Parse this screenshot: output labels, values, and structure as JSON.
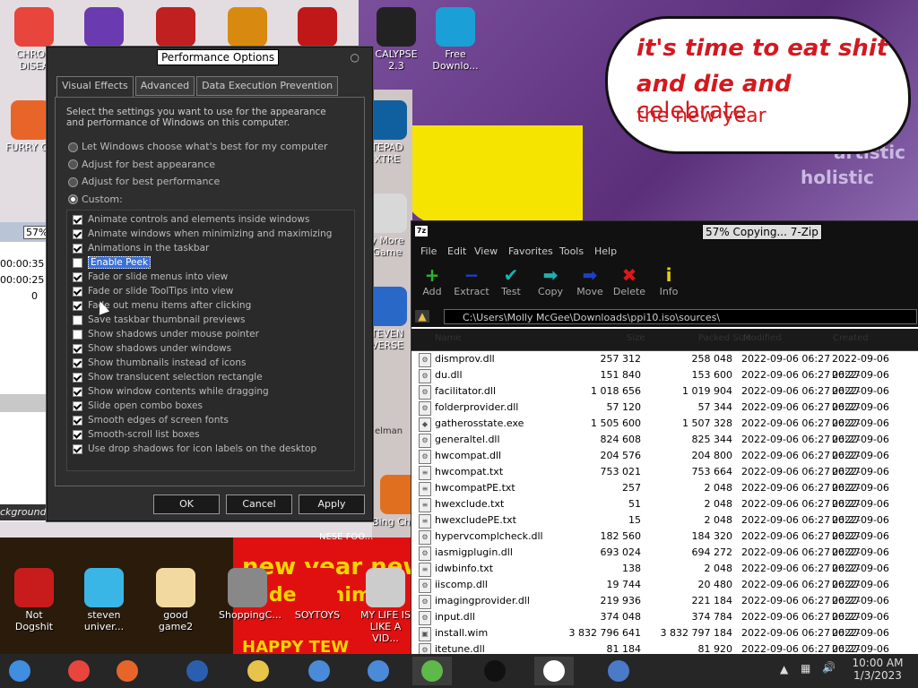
{
  "desktop": {
    "speech_bubble": {
      "line1": "it's time to eat shit",
      "line2_bold": "and die and",
      "line2_normal": "celebrate",
      "line3": "the new year"
    },
    "art_text_1": "artistic",
    "art_text_2": "holistic",
    "icons": [
      {
        "label": "CHRON DISEA",
        "icon": "chrome-icon",
        "color": "#e8453c"
      },
      {
        "label": "",
        "icon": "visual-studio-icon",
        "color": "#6a3bb0"
      },
      {
        "label": "",
        "icon": "bubble-2-icon",
        "color": "#c02020"
      },
      {
        "label": "",
        "icon": "p-logo-icon",
        "color": "#d88a10"
      },
      {
        "label": "",
        "icon": "devil-icon",
        "color": "#c01818"
      },
      {
        "label": "CALYPSE 2.3",
        "icon": "terminal-icon",
        "color": "#222222"
      },
      {
        "label": "Free Downlo...",
        "icon": "download-icon",
        "color": "#1a9fd6"
      },
      {
        "label": "FURRY CO",
        "icon": "firefox-icon",
        "color": "#e8652a"
      },
      {
        "label": "TEPAD XTRE",
        "icon": "notepad-icon",
        "color": "#1060a0"
      },
      {
        "label": "y More Game",
        "icon": "popcap-icon",
        "color": "#d8d8d8"
      },
      {
        "label": "TEVEN VERSE",
        "icon": "steven-icon",
        "color": "#2a68c8"
      },
      {
        "label": "Bing Chillin",
        "icon": "bing-icon",
        "color": "#e07020"
      },
      {
        "label": "Not Dogshit",
        "icon": "dev-cpp-icon",
        "color": "#c81c1c"
      },
      {
        "label": "steven univer...",
        "icon": "diamond-icon",
        "color": "#3ab6e6"
      },
      {
        "label": "good game2",
        "icon": "torii-icon",
        "color": "#f2d9a0"
      },
      {
        "label": "ShoppingC...",
        "icon": "flash-icon",
        "color": "#888888"
      },
      {
        "label": "SOYTOYS",
        "icon": "s-logo-icon",
        "color": "#e01010"
      },
      {
        "label": "MY LIFE IS LIKE A VID...",
        "icon": "gamepad-icon",
        "color": "#cccccc"
      }
    ],
    "red_banner_text": "new year new",
    "red_banner_text2": "jaiden anime",
    "red_banner_text3": "HAPPY TEW",
    "dark_banner_text": "NESE FOO...",
    "elman_text": "elman"
  },
  "left_window": {
    "percent": "57%",
    "time1": "00:00:35",
    "time2": "00:00:25",
    "value": "0",
    "footer": "ckground"
  },
  "perf": {
    "title": "Performance Options",
    "tabs": [
      "Visual Effects",
      "Advanced",
      "Data Execution Prevention"
    ],
    "description": "Select the settings you want to use for the appearance and performance of Windows on this computer.",
    "radios": [
      {
        "label": "Let Windows choose what's best for my computer",
        "selected": false
      },
      {
        "label": "Adjust for best appearance",
        "selected": false
      },
      {
        "label": "Adjust for best performance",
        "selected": false
      },
      {
        "label": "Custom:",
        "selected": true
      }
    ],
    "options": [
      {
        "label": "Animate controls and elements inside windows",
        "checked": true
      },
      {
        "label": "Animate windows when minimizing and maximizing",
        "checked": true
      },
      {
        "label": "Animations in the taskbar",
        "checked": true
      },
      {
        "label": "Enable Peek",
        "checked": false,
        "focused": true
      },
      {
        "label": "Fade or slide menus into view",
        "checked": true
      },
      {
        "label": "Fade or slide ToolTips into view",
        "checked": true
      },
      {
        "label": "Fade out menu items after clicking",
        "checked": true
      },
      {
        "label": "Save taskbar thumbnail previews",
        "checked": false
      },
      {
        "label": "Show shadows under mouse pointer",
        "checked": false
      },
      {
        "label": "Show shadows under windows",
        "checked": true
      },
      {
        "label": "Show thumbnails instead of icons",
        "checked": true
      },
      {
        "label": "Show translucent selection rectangle",
        "checked": true
      },
      {
        "label": "Show window contents while dragging",
        "checked": true
      },
      {
        "label": "Slide open combo boxes",
        "checked": true
      },
      {
        "label": "Smooth edges of screen fonts",
        "checked": true
      },
      {
        "label": "Smooth-scroll list boxes",
        "checked": true
      },
      {
        "label": "Use drop shadows for icon labels on the desktop",
        "checked": true
      }
    ],
    "buttons": {
      "ok": "OK",
      "cancel": "Cancel",
      "apply": "Apply"
    }
  },
  "zip": {
    "title": "57% Copying... 7-Zip",
    "menu": [
      "File",
      "Edit",
      "View",
      "Favorites",
      "Tools",
      "Help"
    ],
    "tools": [
      {
        "label": "Add",
        "icon": "plus-icon",
        "glyph": "+",
        "color": "#2cb52c"
      },
      {
        "label": "Extract",
        "icon": "minus-icon",
        "glyph": "−",
        "color": "#1d3fd1"
      },
      {
        "label": "Test",
        "icon": "check-icon",
        "glyph": "✔",
        "color": "#19b3b3"
      },
      {
        "label": "Copy",
        "icon": "copy-arrow-icon",
        "glyph": "➡",
        "color": "#19b3b3"
      },
      {
        "label": "Move",
        "icon": "move-arrow-icon",
        "glyph": "➡",
        "color": "#1d3fd1"
      },
      {
        "label": "Delete",
        "icon": "delete-x-icon",
        "glyph": "✖",
        "color": "#e01515"
      },
      {
        "label": "Info",
        "icon": "info-icon",
        "glyph": "i",
        "color": "#e6d000"
      }
    ],
    "path": "C:\\Users\\Molly McGee\\Downloads\\ppi10.iso\\sources\\",
    "columns": [
      "Name",
      "Size",
      "Packed Size",
      "Modified",
      "Created"
    ],
    "files": [
      {
        "name": "dismprov.dll",
        "type": "dll",
        "size": "257 312",
        "packed": "258 048",
        "modified": "2022-09-06 06:27",
        "created": "2022-09-06 06:27"
      },
      {
        "name": "du.dll",
        "type": "dll",
        "size": "151 840",
        "packed": "153 600",
        "modified": "2022-09-06 06:27",
        "created": "2022-09-06 06:27"
      },
      {
        "name": "facilitator.dll",
        "type": "dll",
        "size": "1 018 656",
        "packed": "1 019 904",
        "modified": "2022-09-06 06:27",
        "created": "2022-09-06 06:27"
      },
      {
        "name": "folderprovider.dll",
        "type": "dll",
        "size": "57 120",
        "packed": "57 344",
        "modified": "2022-09-06 06:27",
        "created": "2022-09-06 06:27"
      },
      {
        "name": "gatherosstate.exe",
        "type": "exe",
        "size": "1 505 600",
        "packed": "1 507 328",
        "modified": "2022-09-06 06:27",
        "created": "2022-09-06 06:27"
      },
      {
        "name": "generaltel.dll",
        "type": "dll",
        "size": "824 608",
        "packed": "825 344",
        "modified": "2022-09-06 06:27",
        "created": "2022-09-06 06:27"
      },
      {
        "name": "hwcompat.dll",
        "type": "dll",
        "size": "204 576",
        "packed": "204 800",
        "modified": "2022-09-06 06:27",
        "created": "2022-09-06 06:27"
      },
      {
        "name": "hwcompat.txt",
        "type": "txt",
        "size": "753 021",
        "packed": "753 664",
        "modified": "2022-09-06 06:27",
        "created": "2022-09-06 06:27"
      },
      {
        "name": "hwcompatPE.txt",
        "type": "txt",
        "size": "257",
        "packed": "2 048",
        "modified": "2022-09-06 06:27",
        "created": "2022-09-06 06:27"
      },
      {
        "name": "hwexclude.txt",
        "type": "txt",
        "size": "51",
        "packed": "2 048",
        "modified": "2022-09-06 06:27",
        "created": "2022-09-06 06:27"
      },
      {
        "name": "hwexcludePE.txt",
        "type": "txt",
        "size": "15",
        "packed": "2 048",
        "modified": "2022-09-06 06:27",
        "created": "2022-09-06 06:27"
      },
      {
        "name": "hypervcomplcheck.dll",
        "type": "dll",
        "size": "182 560",
        "packed": "184 320",
        "modified": "2022-09-06 06:27",
        "created": "2022-09-06 06:27"
      },
      {
        "name": "iasmigplugin.dll",
        "type": "dll",
        "size": "693 024",
        "packed": "694 272",
        "modified": "2022-09-06 06:27",
        "created": "2022-09-06 06:27"
      },
      {
        "name": "idwbinfo.txt",
        "type": "txt",
        "size": "138",
        "packed": "2 048",
        "modified": "2022-09-06 06:27",
        "created": "2022-09-06 06:27"
      },
      {
        "name": "iiscomp.dll",
        "type": "dll",
        "size": "19 744",
        "packed": "20 480",
        "modified": "2022-09-06 06:27",
        "created": "2022-09-06 06:27"
      },
      {
        "name": "imagingprovider.dll",
        "type": "dll",
        "size": "219 936",
        "packed": "221 184",
        "modified": "2022-09-06 06:27",
        "created": "2022-09-06 06:27"
      },
      {
        "name": "input.dll",
        "type": "dll",
        "size": "374 048",
        "packed": "374 784",
        "modified": "2022-09-06 06:27",
        "created": "2022-09-06 06:27"
      },
      {
        "name": "install.wim",
        "type": "wim",
        "size": "3 832 796 641",
        "packed": "3 832 797 184",
        "modified": "2022-09-06 06:27",
        "created": "2022-09-06 06:27"
      },
      {
        "name": "itetune.dll",
        "type": "dll",
        "size": "81 184",
        "packed": "81 920",
        "modified": "2022-09-06 06:27",
        "created": "2022-09-06 06:27"
      }
    ]
  },
  "taskbar": {
    "items": [
      {
        "icon": "start-orb-icon",
        "active": false
      },
      {
        "icon": "chrome-icon",
        "active": false
      },
      {
        "icon": "firefox-icon",
        "active": false
      },
      {
        "icon": "campaign-logo-icon",
        "active": false
      },
      {
        "icon": "file-explorer-icon",
        "active": false
      },
      {
        "icon": "control-panel-icon",
        "active": false
      },
      {
        "icon": "control-panel-icon",
        "active": false
      },
      {
        "icon": "users-icon",
        "active": true
      },
      {
        "icon": "cmd-icon",
        "active": false
      },
      {
        "icon": "7zip-icon",
        "active": true
      },
      {
        "icon": "remote-desktop-icon",
        "active": false
      }
    ],
    "time": "10:00 AM",
    "date": "1/3/2023"
  }
}
